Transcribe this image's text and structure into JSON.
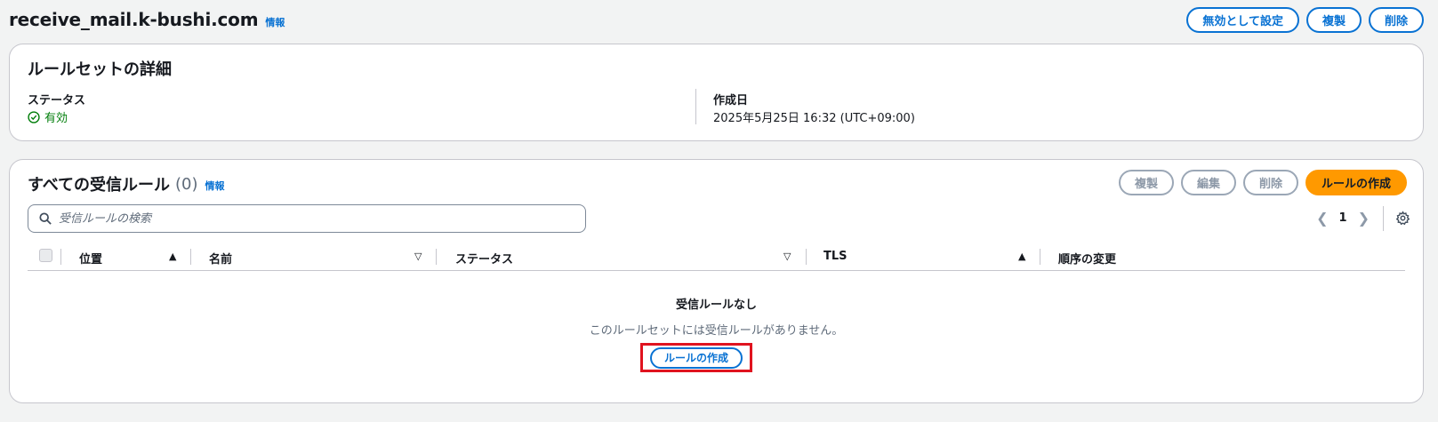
{
  "header": {
    "title": "receive_mail.k-bushi.com",
    "info_label": "情報",
    "actions": {
      "disable": "無効として設定",
      "duplicate": "複製",
      "delete": "削除"
    }
  },
  "details": {
    "title": "ルールセットの詳細",
    "status_label": "ステータス",
    "status_value": "有効",
    "created_label": "作成日",
    "created_value": "2025年5月25日 16:32 (UTC+09:00)"
  },
  "rules": {
    "title": "すべての受信ルール",
    "count": "(0)",
    "info_label": "情報",
    "actions": {
      "duplicate": "複製",
      "edit": "編集",
      "delete": "削除",
      "create": "ルールの作成"
    },
    "search": {
      "placeholder": "受信ルールの検索",
      "value": ""
    },
    "pagination": {
      "current_page": "1"
    },
    "columns": {
      "position": "位置",
      "name": "名前",
      "status": "ステータス",
      "tls": "TLS",
      "order": "順序の変更"
    },
    "empty": {
      "title": "受信ルールなし",
      "description": "このルールセットには受信ルールがありません。",
      "create_label": "ルールの作成"
    }
  },
  "colors": {
    "accent": "#0972d3",
    "primary": "#ff9900",
    "success": "#037f0c",
    "highlight": "#e0131f"
  }
}
